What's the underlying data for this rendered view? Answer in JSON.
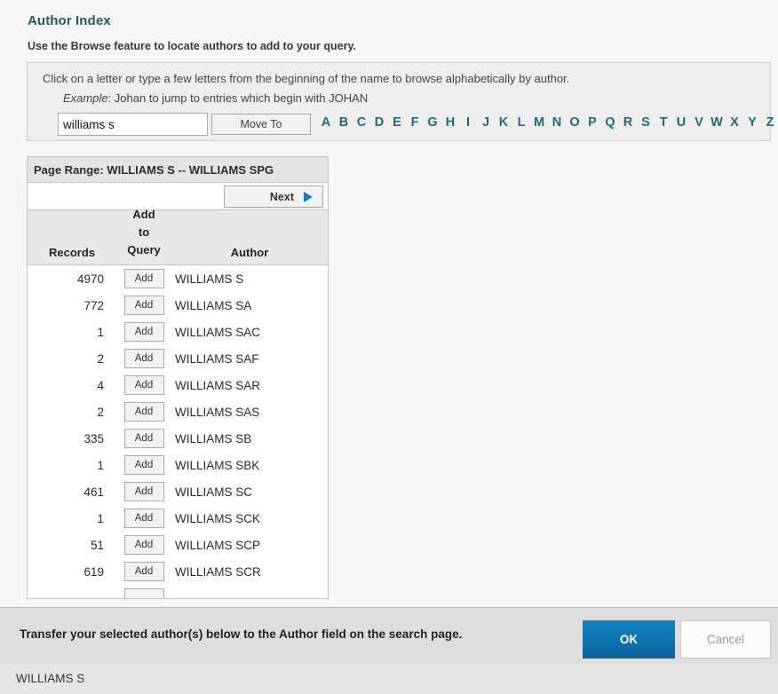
{
  "header": {
    "title": "Author Index",
    "subtitle": "Use the Browse feature to locate authors to add to your query."
  },
  "browse": {
    "instruction": "Click on a letter or type a few letters from the beginning of the name to browse alphabetically by author.",
    "example_label": "Example",
    "example_text": ": Johan to jump to entries which begin with JOHAN",
    "input_value": "williams s",
    "input_placeholder": "",
    "move_to_label": "Move To",
    "alphabet": [
      "A",
      "B",
      "C",
      "D",
      "E",
      "F",
      "G",
      "H",
      "I",
      "J",
      "K",
      "L",
      "M",
      "N",
      "O",
      "P",
      "Q",
      "R",
      "S",
      "T",
      "U",
      "V",
      "W",
      "X",
      "Y",
      "Z"
    ],
    "link_color": "#1e6b80"
  },
  "results": {
    "page_range": "Page Range: WILLIAMS S -- WILLIAMS SPG",
    "next_label": "Next",
    "next_icon": "triangle-right-icon",
    "columns": {
      "records": "Records",
      "add_line1": "Add",
      "add_line2": "to",
      "add_line3": "Query",
      "author": "Author"
    },
    "add_button_label": "Add",
    "rows": [
      {
        "records": "4970",
        "author": "WILLIAMS S"
      },
      {
        "records": "772",
        "author": "WILLIAMS SA"
      },
      {
        "records": "1",
        "author": "WILLIAMS SAC"
      },
      {
        "records": "2",
        "author": "WILLIAMS SAF"
      },
      {
        "records": "4",
        "author": "WILLIAMS SAR"
      },
      {
        "records": "2",
        "author": "WILLIAMS SAS"
      },
      {
        "records": "335",
        "author": "WILLIAMS SB"
      },
      {
        "records": "1",
        "author": "WILLIAMS SBK"
      },
      {
        "records": "461",
        "author": "WILLIAMS SC"
      },
      {
        "records": "1",
        "author": "WILLIAMS SCK"
      },
      {
        "records": "51",
        "author": "WILLIAMS SCP"
      },
      {
        "records": "619",
        "author": "WILLIAMS SCR"
      }
    ]
  },
  "transfer": {
    "message": "Transfer your selected author(s) below to the Author field on the search page.",
    "ok_label": "OK",
    "cancel_label": "Cancel",
    "ok_color": "#0e74b0",
    "selected_authors": "WILLIAMS S"
  }
}
